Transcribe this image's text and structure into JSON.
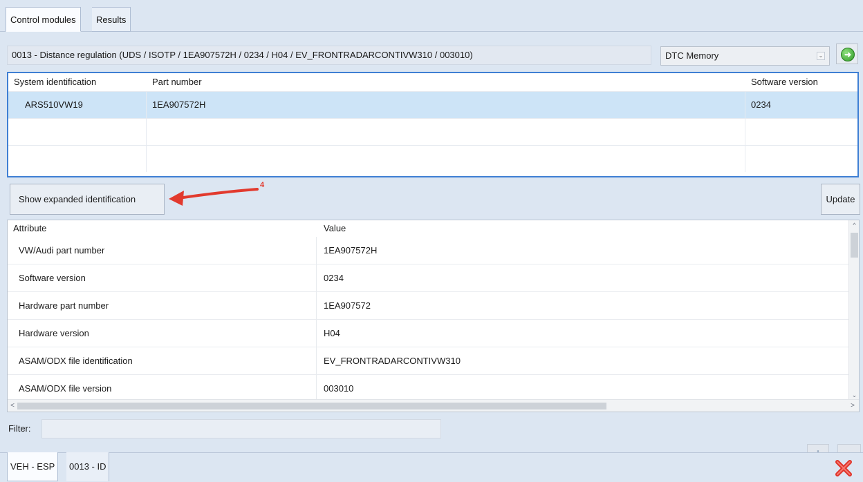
{
  "top_tabs": [
    {
      "label": "Control modules",
      "active": true
    },
    {
      "label": "Results",
      "active": false
    }
  ],
  "module_header": {
    "title": "0013 - Distance regulation  (UDS / ISOTP / 1EA907572H / 0234 / H04 / EV_FRONTRADARCONTIVW310 / 003010)",
    "view_select": "DTC Memory",
    "go_icon": "green-arrow-right-icon"
  },
  "identification_table": {
    "headers": {
      "system": "System identification",
      "part": "Part number",
      "software": "Software version"
    },
    "rows": [
      {
        "system": "ARS510VW19",
        "part": "1EA907572H",
        "software": "0234"
      },
      {
        "system": "",
        "part": "",
        "software": ""
      },
      {
        "system": "",
        "part": "",
        "software": ""
      }
    ]
  },
  "buttons": {
    "show_expanded": "Show expanded identification",
    "update": "Update"
  },
  "annotation": {
    "number": "4",
    "color": "#e23a2e"
  },
  "attribute_table": {
    "headers": {
      "attribute": "Attribute",
      "value": "Value"
    },
    "rows": [
      {
        "attribute": "VW/Audi part number",
        "value": "1EA907572H"
      },
      {
        "attribute": "Software version",
        "value": "0234"
      },
      {
        "attribute": "Hardware part number",
        "value": "1EA907572"
      },
      {
        "attribute": "Hardware version",
        "value": "H04"
      },
      {
        "attribute": "ASAM/ODX file identification",
        "value": "EV_FRONTRADARCONTIVW310"
      },
      {
        "attribute": "ASAM/ODX file version",
        "value": "003010"
      }
    ]
  },
  "filter": {
    "label": "Filter:",
    "value": ""
  },
  "bottom_tabs": [
    {
      "label": "VEH - ESP",
      "active": true
    },
    {
      "label": "0013 - ID",
      "active": false
    }
  ],
  "colors": {
    "selection_border": "#3f7fd4",
    "selected_row": "#cde4f7",
    "close_red": "#e0342a"
  }
}
